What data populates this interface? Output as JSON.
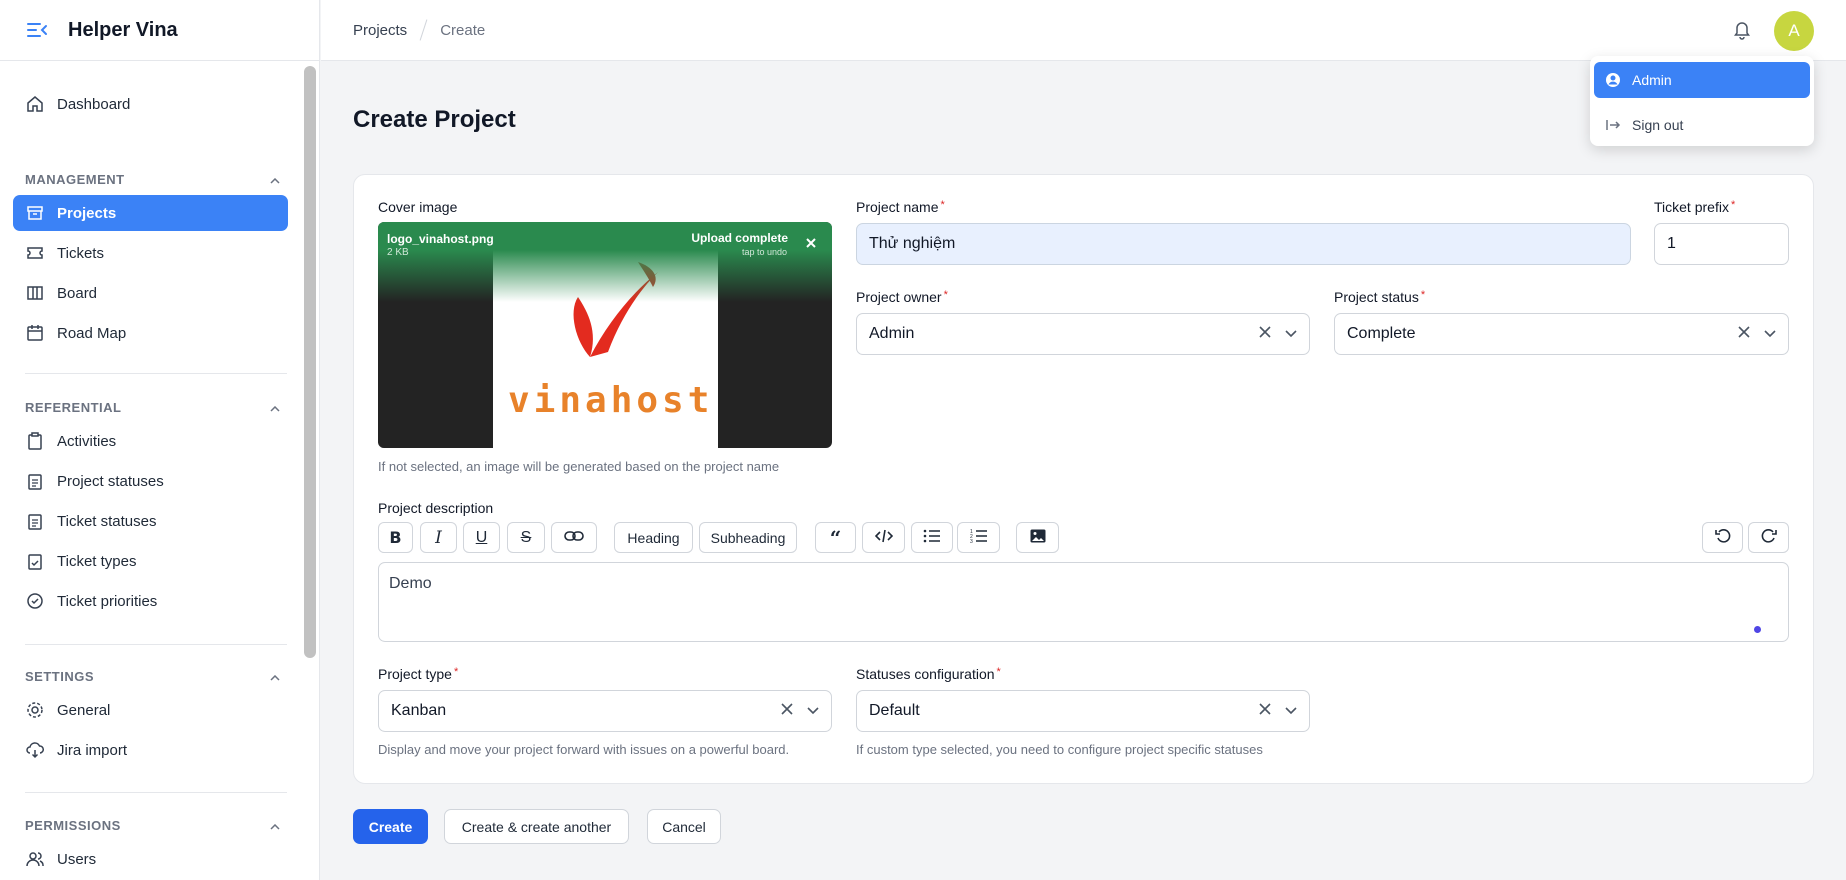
{
  "app": {
    "title": "Helper Vina"
  },
  "breadcrumb": [
    "Projects",
    "Create"
  ],
  "user": {
    "avatar_initial": "A"
  },
  "user_menu": {
    "items": [
      "Admin",
      "Sign out"
    ]
  },
  "sidebar": {
    "dashboard": "Dashboard",
    "groups": [
      {
        "label": "MANAGEMENT",
        "items": [
          "Projects",
          "Tickets",
          "Board",
          "Road Map"
        ]
      },
      {
        "label": "REFERENTIAL",
        "items": [
          "Activities",
          "Project statuses",
          "Ticket statuses",
          "Ticket types",
          "Ticket priorities"
        ]
      },
      {
        "label": "SETTINGS",
        "items": [
          "General",
          "Jira import"
        ]
      },
      {
        "label": "PERMISSIONS",
        "items": [
          "Users"
        ]
      }
    ]
  },
  "page": {
    "title": "Create Project"
  },
  "form": {
    "cover": {
      "label": "Cover image",
      "file_name": "logo_vinahost.png",
      "file_size": "2 KB",
      "status": "Upload complete",
      "undo": "tap to undo",
      "logo_text": "vinahost",
      "hint": "If not selected, an image will be generated based on the project name"
    },
    "project_name": {
      "label": "Project name",
      "value": "Thử nghiệm"
    },
    "ticket_prefix": {
      "label": "Ticket prefix",
      "value": "1"
    },
    "project_owner": {
      "label": "Project owner",
      "value": "Admin"
    },
    "project_status": {
      "label": "Project status",
      "value": "Complete"
    },
    "description": {
      "label": "Project description",
      "value": "Demo",
      "toolbar": {
        "heading": "Heading",
        "subheading": "Subheading"
      }
    },
    "project_type": {
      "label": "Project type",
      "value": "Kanban",
      "hint": "Display and move your project forward with issues on a powerful board."
    },
    "statuses_configuration": {
      "label": "Statuses configuration",
      "value": "Default",
      "hint": "If custom type selected, you need to configure project specific statuses"
    }
  },
  "actions": {
    "create": "Create",
    "create_another": "Create & create another",
    "cancel": "Cancel"
  },
  "colors": {
    "primary": "#2563eb",
    "nav_active": "#3b82f6",
    "avatar": "#c7d640",
    "cover_green": "#2a8a4e"
  }
}
